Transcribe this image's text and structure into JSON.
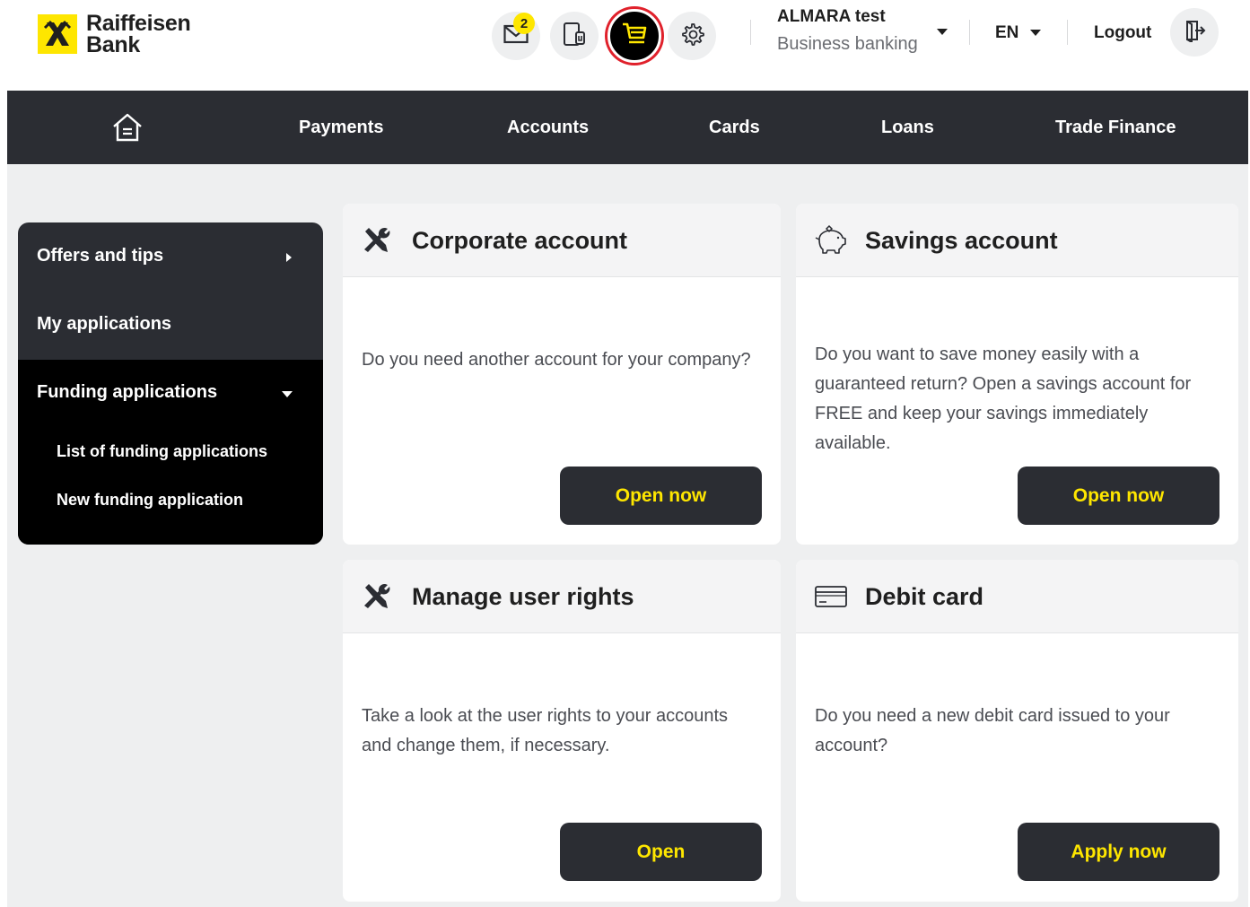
{
  "brand": {
    "line1": "Raiffeisen",
    "line2": "Bank"
  },
  "header": {
    "messages_badge": "2",
    "user_name": "ALMARA test",
    "user_role": "Business banking",
    "language": "EN",
    "logout_label": "Logout",
    "icons": [
      "mail-icon",
      "mobile-device-icon",
      "shopping-cart-icon",
      "settings-gear-icon",
      "logout-icon"
    ]
  },
  "nav": {
    "items": [
      "Payments",
      "Accounts",
      "Cards",
      "Loans",
      "Trade Finance"
    ]
  },
  "sidebar": {
    "items": [
      {
        "label": "Offers and tips"
      },
      {
        "label": "My applications"
      },
      {
        "label": "Funding applications"
      }
    ],
    "sub_items": [
      {
        "label": "List of funding applications"
      },
      {
        "label": "New funding application"
      }
    ]
  },
  "cards": [
    {
      "icon": "tools-icon",
      "title": "Corporate account",
      "text": "Do you need another account for your company?",
      "button": "Open now"
    },
    {
      "icon": "piggy-bank-icon",
      "title": "Savings account",
      "text": "Do you want to save money easily with a guaranteed return? Open a savings account for FREE and keep your savings immediately available.",
      "button": "Open now"
    },
    {
      "icon": "tools-icon",
      "title": "Manage user rights",
      "text": "Take a look at the user rights to your accounts and change them, if necessary.",
      "button": "Open"
    },
    {
      "icon": "debit-card-icon",
      "title": "Debit card",
      "text": "Do you need a new debit card issued to your account?",
      "button": "Apply now"
    }
  ],
  "colors": {
    "brand_yellow": "#fee600",
    "dark": "#2b2d33",
    "highlight_ring": "#e0212b",
    "page_bg": "#eeeff0"
  }
}
